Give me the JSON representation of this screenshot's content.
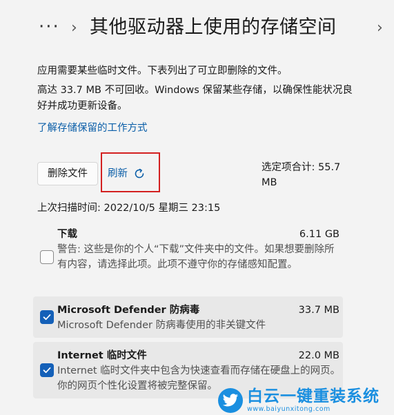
{
  "header": {
    "more_label": "···",
    "title": "其他驱动器上使用的存储空间"
  },
  "intro_text": "应用需要某些临时文件。下表列出了可立即删除的文件。",
  "detail_text": "高达 33.7 MB 不可回收。Windows 保留某些存储，以确保性能状况良好并成功更新设备。",
  "learn_link": "了解存储保留的工作方式",
  "actions": {
    "delete_label": "删除文件",
    "refresh_label": "刷新"
  },
  "selected_total": "选定项合计: 55.7 MB",
  "last_scan": "上次扫描时间: 2022/10/5 星期三 23:15",
  "items": [
    {
      "name": "下载",
      "size": "6.11 GB",
      "checked": false,
      "description": "警告: 这些是你的个人“下载”文件夹中的文件。如果想要删除所有内容，请选择此项。此项不遵守你的存储感知配置。"
    },
    {
      "name": "Microsoft Defender 防病毒",
      "size": "33.7 MB",
      "checked": true,
      "description": "Microsoft Defender 防病毒使用的非关键文件"
    },
    {
      "name": "Internet 临时文件",
      "size": "22.0 MB",
      "checked": true,
      "description": "Internet 临时文件夹中包含为快速查看而存储在硬盘上的网页。你的网页个性化设置将被完整保留。"
    }
  ],
  "watermark": {
    "title": "白云一键重装系统",
    "url": "www.baiyunxitong.com"
  },
  "colors": {
    "accent": "#1460b8",
    "link": "#0a5ea8",
    "highlight_box": "#d32020",
    "watermark": "#1a8fe0"
  }
}
